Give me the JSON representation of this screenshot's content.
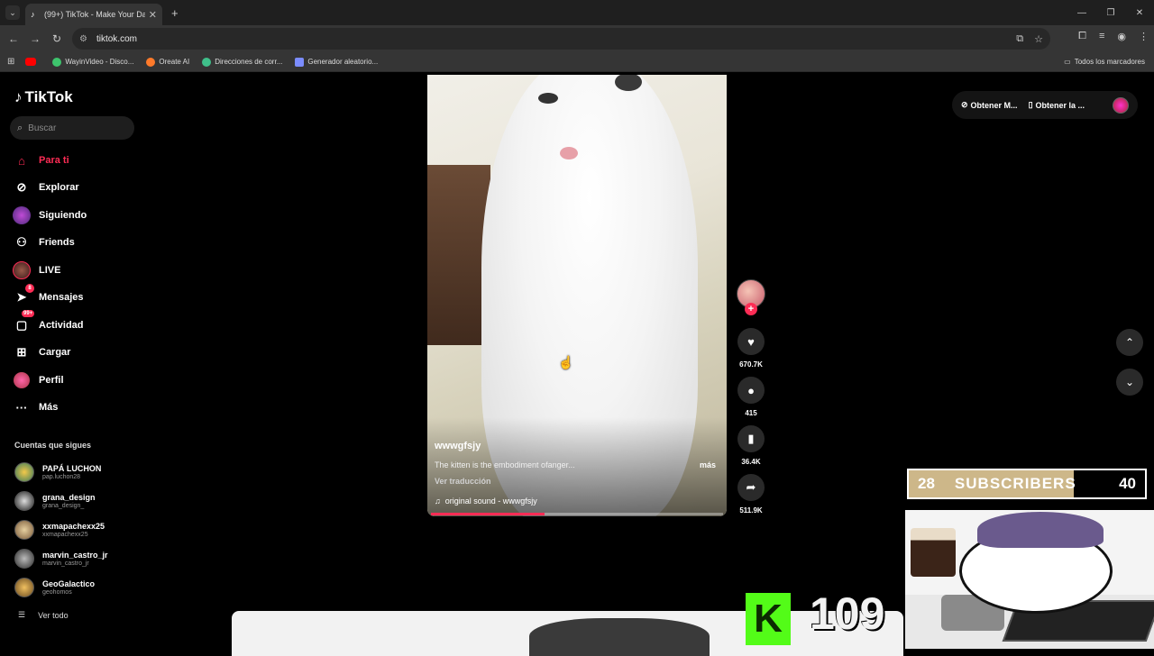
{
  "browser": {
    "tab_title": "(99+) TikTok - Make Your Da",
    "url": "tiktok.com",
    "bookmarks": [
      {
        "label": "",
        "color": "#ff0000"
      },
      {
        "label": "WayinVideo - Disco...",
        "color": "#3ec46d"
      },
      {
        "label": "Oreate AI",
        "color": "#ff7a2a"
      },
      {
        "label": "Direcciones de corr...",
        "color": "#3fbf8a"
      },
      {
        "label": "Generador aleatorio...",
        "color": "#7b8cff"
      }
    ],
    "bookmarks_all": "Todos los marcadores"
  },
  "sidebar": {
    "logo": "TikTok",
    "search_placeholder": "Buscar",
    "nav": [
      {
        "label": "Para ti",
        "icon": "home-icon",
        "active": true
      },
      {
        "label": "Explorar",
        "icon": "compass-icon"
      },
      {
        "label": "Siguiendo",
        "icon": "following-avatar-icon"
      },
      {
        "label": "Friends",
        "icon": "friends-icon"
      },
      {
        "label": "LIVE",
        "icon": "live-avatar-icon"
      },
      {
        "label": "Mensajes",
        "icon": "messages-icon",
        "badge": "8"
      },
      {
        "label": "Actividad",
        "icon": "activity-icon",
        "badge": "99+"
      },
      {
        "label": "Cargar",
        "icon": "upload-icon"
      },
      {
        "label": "Perfil",
        "icon": "profile-avatar-icon"
      },
      {
        "label": "Más",
        "icon": "more-icon"
      }
    ],
    "following_title": "Cuentas que sigues",
    "following": [
      {
        "name": "PAPÁ LUCHON",
        "handle": "pap.luchon28"
      },
      {
        "name": "grana_design",
        "handle": "grana_design_"
      },
      {
        "name": "xxmapachexx25",
        "handle": "xxmapachexx25"
      },
      {
        "name": "marvin_castro_jr",
        "handle": "marvin_castro_jr"
      },
      {
        "name": "GeoGalactico",
        "handle": "geohomos"
      }
    ],
    "see_all": "Ver todo"
  },
  "video": {
    "username": "wwwgfsjy",
    "description": "The kitten is the embodiment ofanger...",
    "more": "más",
    "translate": "Ver traducción",
    "sound": "original sound - wwwgfsjy",
    "progress": 0.39
  },
  "actions": {
    "likes": "670.7K",
    "comments": "415",
    "saves": "36.4K",
    "shares": "511.9K"
  },
  "top_right": {
    "get_coins": "Obtener M...",
    "get_app": "Obtener la ..."
  },
  "overlay": {
    "sub_current": "28",
    "sub_label": "SUBSCRIBERS",
    "sub_goal": "40",
    "kick_letter": "K",
    "kick_count": "109",
    "sub_progress": 0.7
  }
}
